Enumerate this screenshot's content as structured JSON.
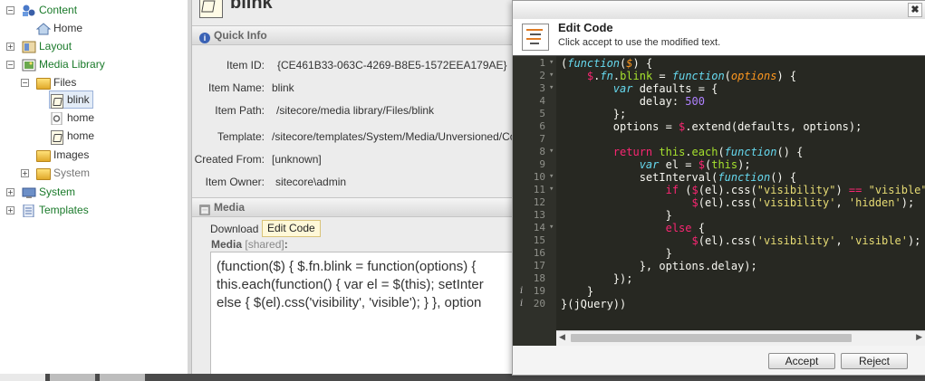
{
  "tree": {
    "content": "Content",
    "home": "Home",
    "layout": "Layout",
    "media_library": "Media Library",
    "files": "Files",
    "blink": "blink",
    "home1": "home",
    "home2": "home",
    "images": "Images",
    "system_inner": "System",
    "system": "System",
    "templates": "Templates"
  },
  "content": {
    "title": "blink",
    "quick_info": "Quick Info",
    "fields": [
      {
        "label": "Item ID:",
        "value": "{CE461B33-063C-4269-B8E5-1572EEA179AE}"
      },
      {
        "label": "Item Name:",
        "value": "blink"
      },
      {
        "label": "Item Path:",
        "value": "/sitecore/media library/Files/blink"
      },
      {
        "label": "Template:",
        "value": "/sitecore/templates/System/Media/Unversioned/Code -"
      },
      {
        "label": "Created From:",
        "value": "[unknown]"
      },
      {
        "label": "Item Owner:",
        "value": "sitecore\\admin"
      }
    ],
    "media_section": "Media",
    "download": "Download",
    "edit_code": "Edit Code",
    "media_label": "Media",
    "media_shared": "[shared]",
    "media_colon": ":",
    "media_lines": [
      "(function($) { $.fn.blink = function(options) {",
      "this.each(function() { var el = $(this); setInter",
      "else { $(el).css('visibility', 'visible'); } }, option"
    ]
  },
  "dialog": {
    "title": "Edit Code",
    "subtitle": "Click accept to use the modified text.",
    "close": "✖",
    "accept": "Accept",
    "reject": "Reject"
  },
  "code_lines": [
    "1",
    "2",
    "3",
    "4",
    "5",
    "6",
    "7",
    "8",
    "9",
    "10",
    "11",
    "12",
    "13",
    "14",
    "15",
    "16",
    "17",
    "18",
    "19",
    "20"
  ]
}
